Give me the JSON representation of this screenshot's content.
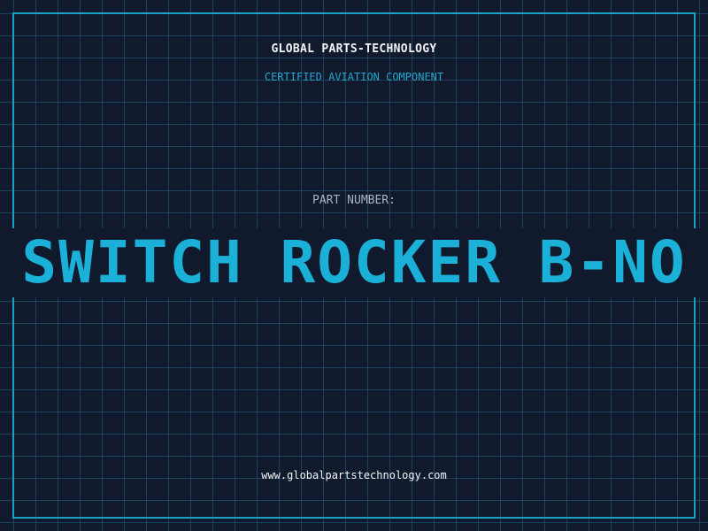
{
  "header": {
    "company": "GLOBAL PARTS-TECHNOLOGY",
    "subtitle": "CERTIFIED AVIATION COMPONENT"
  },
  "part": {
    "label": "PART NUMBER:",
    "number": "SWITCH ROCKER B-NO"
  },
  "footer": {
    "website": "www.globalpartstechnology.com"
  },
  "colors": {
    "background": "#101a2c",
    "grid": "#266080",
    "frame": "#1b9fc4",
    "accent": "#1bb0d8",
    "title": "#f2f4f8",
    "label": "#aab4c4"
  }
}
